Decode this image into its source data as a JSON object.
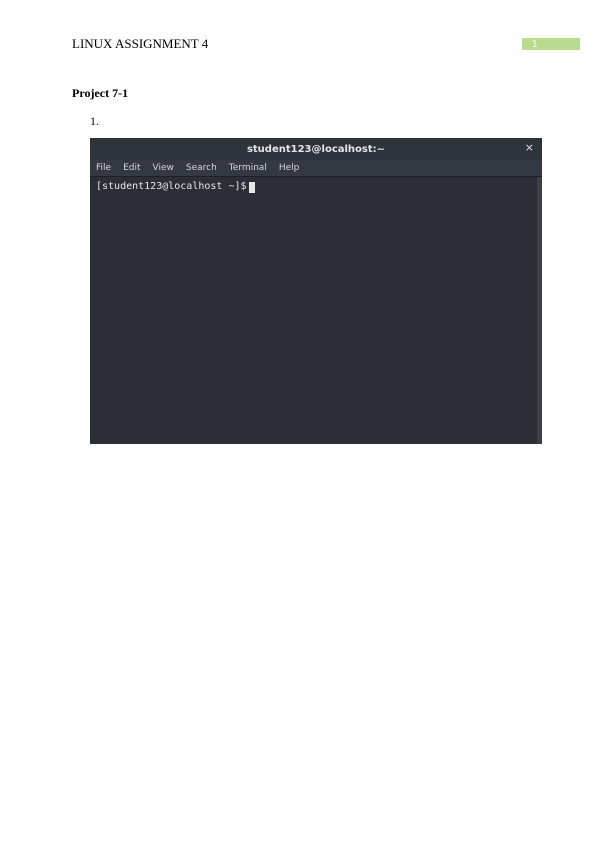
{
  "header": {
    "title": "LINUX ASSIGNMENT 4",
    "page_number": "1"
  },
  "section": {
    "heading": "Project 7-1",
    "list_item_number": "1."
  },
  "terminal": {
    "title": "student123@localhost:~",
    "close_symbol": "×",
    "menu": {
      "file": "File",
      "edit": "Edit",
      "view": "View",
      "search": "Search",
      "terminal": "Terminal",
      "help": "Help"
    },
    "prompt": "[student123@localhost ~]$ "
  }
}
